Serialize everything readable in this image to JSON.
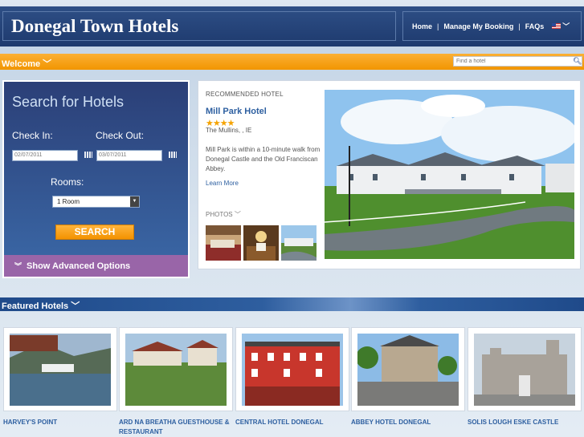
{
  "header": {
    "site_title": "Donegal Town Hotels",
    "nav": {
      "home": "Home",
      "manage": "Manage My Booking",
      "faqs": "FAQs",
      "sep": "|"
    }
  },
  "welcome": {
    "label": "Welcome",
    "search_placeholder": "Find a hotel"
  },
  "search": {
    "title": "Search for Hotels",
    "check_in_label": "Check In:",
    "check_out_label": "Check Out:",
    "check_in_value": "02/07/2011",
    "check_out_value": "03/07/2011",
    "rooms_label": "Rooms:",
    "rooms_value": "1 Room",
    "button": "SEARCH",
    "advanced": "Show Advanced Options"
  },
  "recommended": {
    "label": "RECOMMENDED HOTEL",
    "name": "Mill Park Hotel",
    "stars": "★★★★",
    "location": "The Mullins, , IE",
    "description": "Mill Park is within a 10-minute walk from Donegal Castle and the Old Franciscan Abbey.",
    "learn_more": "Learn More",
    "photos_label": "PHOTOS"
  },
  "featured": {
    "label": "Featured Hotels",
    "hotels": [
      {
        "name": "HARVEY'S POINT"
      },
      {
        "name": "ARD NA BREATHA GUESTHOUSE & RESTAURANT"
      },
      {
        "name": "CENTRAL HOTEL DONEGAL"
      },
      {
        "name": "ABBEY HOTEL DONEGAL"
      },
      {
        "name": "SOLIS LOUGH ESKE CASTLE"
      }
    ]
  },
  "colors": {
    "accent_orange": "#f29500",
    "header_blue": "#1e3a6e",
    "link_blue": "#2d5fa0",
    "purple": "#9965a8"
  },
  "icons": [
    "search-icon",
    "calendar-icon",
    "chevron-down-icon",
    "flag-icon"
  ]
}
